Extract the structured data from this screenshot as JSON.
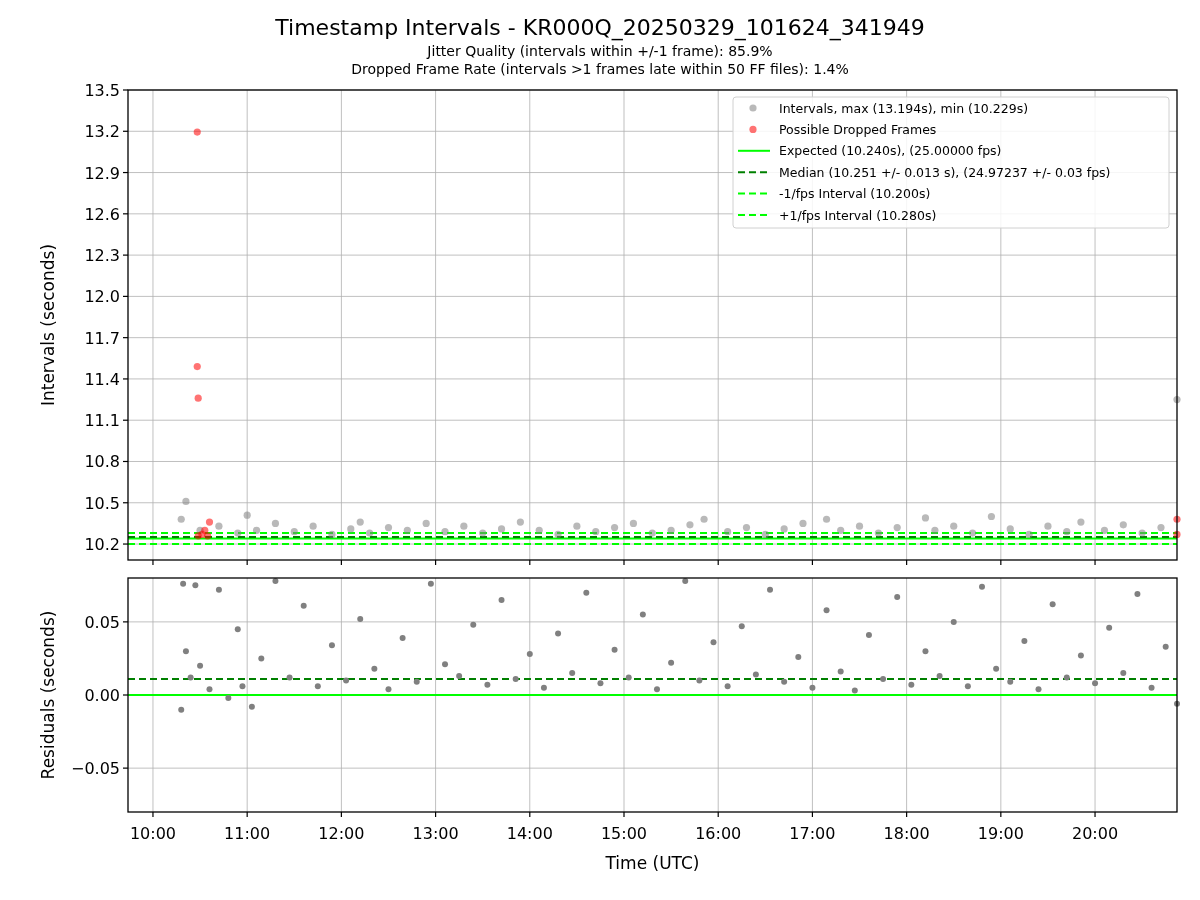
{
  "figure": {
    "title": "Timestamp Intervals - KR000Q_20250329_101624_341949",
    "subtitle_lines": [
      "Jitter Quality (intervals within +/-1 frame): 85.9%",
      "Dropped Frame Rate (intervals >1 frames late within 50 FF files): 1.4%"
    ]
  },
  "charts": [
    {
      "chart_data": {
        "type": "scatter",
        "grid": true,
        "legend": true,
        "ylabel": "Intervals (seconds)",
        "xlim": [
          9.735,
          20.87
        ],
        "ylim": [
          10.084,
          13.5
        ],
        "yticks": [
          {
            "value": 10.2,
            "label": "10.2"
          },
          {
            "value": 10.5,
            "label": "10.5"
          },
          {
            "value": 10.8,
            "label": "10.8"
          },
          {
            "value": 11.1,
            "label": "11.1"
          },
          {
            "value": 11.4,
            "label": "11.4"
          },
          {
            "value": 11.7,
            "label": "11.7"
          },
          {
            "value": 12.0,
            "label": "12.0"
          },
          {
            "value": 12.3,
            "label": "12.3"
          },
          {
            "value": 12.6,
            "label": "12.6"
          },
          {
            "value": 12.9,
            "label": "12.9"
          },
          {
            "value": 13.2,
            "label": "13.2"
          },
          {
            "value": 13.5,
            "label": "13.5"
          }
        ],
        "series": [
          {
            "name": "Intervals, max (13.194s), min (10.229s)",
            "type": "scatter",
            "color": "#808080",
            "x": [
              10.3,
              10.35,
              10.5,
              10.7,
              10.9,
              11.0,
              11.1,
              11.3,
              11.5,
              11.7,
              11.9,
              12.1,
              12.2,
              12.3,
              12.5,
              12.7,
              12.9,
              13.1,
              13.3,
              13.5,
              13.7,
              13.9,
              14.1,
              14.3,
              14.5,
              14.7,
              14.9,
              15.1,
              15.3,
              15.5,
              15.7,
              15.85,
              16.1,
              16.3,
              16.5,
              16.7,
              16.9,
              17.15,
              17.3,
              17.5,
              17.7,
              17.9,
              18.2,
              18.3,
              18.5,
              18.7,
              18.9,
              19.1,
              19.3,
              19.5,
              19.7,
              19.85,
              20.1,
              20.3,
              20.5,
              20.7,
              20.87
            ],
            "values": [
              10.38,
              10.51,
              10.3,
              10.33,
              10.28,
              10.41,
              10.3,
              10.35,
              10.29,
              10.33,
              10.27,
              10.31,
              10.36,
              10.28,
              10.32,
              10.3,
              10.35,
              10.29,
              10.33,
              10.28,
              10.31,
              10.36,
              10.3,
              10.27,
              10.33,
              10.29,
              10.32,
              10.35,
              10.28,
              10.3,
              10.34,
              10.38,
              10.29,
              10.32,
              10.27,
              10.31,
              10.35,
              10.38,
              10.3,
              10.33,
              10.28,
              10.32,
              10.39,
              10.3,
              10.33,
              10.28,
              10.4,
              10.31,
              10.27,
              10.33,
              10.29,
              10.36,
              10.3,
              10.34,
              10.28,
              10.32,
              11.25
            ]
          },
          {
            "name": "Possible Dropped Frames",
            "type": "scatter",
            "color": "#ff0000",
            "x": [
              10.47,
              10.47,
              10.48,
              10.48,
              10.52,
              10.55,
              10.58,
              10.6,
              20.87,
              20.87
            ],
            "values": [
              13.194,
              11.49,
              11.26,
              10.26,
              10.27,
              10.3,
              10.26,
              10.36,
              10.38,
              10.27
            ]
          },
          {
            "name": "Expected (10.240s), (25.00000 fps)",
            "type": "line",
            "color": "#00ff00",
            "x": [
              9.735,
              20.87
            ],
            "values": [
              10.24,
              10.24
            ]
          },
          {
            "name": "Median (10.251 +/- 0.013 s), (24.97237 +/- 0.03 fps)",
            "type": "line",
            "line_style": "dashed",
            "color": "#008000",
            "x": [
              9.735,
              20.87
            ],
            "values": [
              10.251,
              10.251
            ]
          },
          {
            "name": "-1/fps Interval (10.200s)",
            "type": "line",
            "line_style": "dashed",
            "color": "#00ff00",
            "x": [
              9.735,
              20.87
            ],
            "values": [
              10.2,
              10.2
            ]
          },
          {
            "name": "+1/fps Interval (10.280s)",
            "type": "line",
            "line_style": "dashed",
            "color": "#00ff00",
            "x": [
              9.735,
              20.87
            ],
            "values": [
              10.28,
              10.28
            ]
          }
        ]
      }
    },
    {
      "chart_data": {
        "type": "scatter",
        "grid": true,
        "xlabel": "Time (UTC)",
        "ylabel": "Residuals (seconds)",
        "xlim": [
          9.735,
          20.87
        ],
        "ylim": [
          -0.08,
          0.08
        ],
        "xticks": [
          {
            "value": 10,
            "label": "10:00"
          },
          {
            "value": 11,
            "label": "11:00"
          },
          {
            "value": 12,
            "label": "12:00"
          },
          {
            "value": 13,
            "label": "13:00"
          },
          {
            "value": 14,
            "label": "14:00"
          },
          {
            "value": 15,
            "label": "15:00"
          },
          {
            "value": 16,
            "label": "16:00"
          },
          {
            "value": 17,
            "label": "17:00"
          },
          {
            "value": 18,
            "label": "18:00"
          },
          {
            "value": 19,
            "label": "19:00"
          },
          {
            "value": 20,
            "label": "20:00"
          }
        ],
        "yticks": [
          {
            "value": -0.05,
            "label": "−0.05"
          },
          {
            "value": 0,
            "label": "0.00"
          },
          {
            "value": 0.05,
            "label": "0.05"
          }
        ],
        "series": [
          {
            "type": "scatter",
            "color": "#808080",
            "x": [
              10.3,
              10.32,
              10.35,
              10.4,
              10.45,
              10.5,
              10.6,
              10.7,
              10.8,
              10.9,
              10.95,
              11.05,
              11.15,
              11.3,
              11.45,
              11.6,
              11.75,
              11.9,
              12.05,
              12.2,
              12.35,
              12.5,
              12.65,
              12.8,
              12.95,
              13.1,
              13.25,
              13.4,
              13.55,
              13.7,
              13.85,
              14.0,
              14.15,
              14.3,
              14.45,
              14.6,
              14.75,
              14.9,
              15.05,
              15.2,
              15.35,
              15.5,
              15.65,
              15.8,
              15.95,
              16.1,
              16.25,
              16.4,
              16.55,
              16.7,
              16.85,
              17.0,
              17.15,
              17.3,
              17.45,
              17.6,
              17.75,
              17.9,
              18.05,
              18.2,
              18.35,
              18.5,
              18.65,
              18.8,
              18.95,
              19.1,
              19.25,
              19.4,
              19.55,
              19.7,
              19.85,
              20.0,
              20.15,
              20.3,
              20.45,
              20.6,
              20.75,
              20.87
            ],
            "values": [
              -0.01,
              0.076,
              0.03,
              0.012,
              0.075,
              0.02,
              0.004,
              0.072,
              -0.002,
              0.045,
              0.006,
              -0.008,
              0.025,
              0.078,
              0.012,
              0.061,
              0.006,
              0.034,
              0.01,
              0.052,
              0.018,
              0.004,
              0.039,
              0.009,
              0.076,
              0.021,
              0.013,
              0.048,
              0.007,
              0.065,
              0.011,
              0.028,
              0.005,
              0.042,
              0.015,
              0.07,
              0.008,
              0.031,
              0.012,
              0.055,
              0.004,
              0.022,
              0.078,
              0.01,
              0.036,
              0.006,
              0.047,
              0.014,
              0.072,
              0.009,
              0.026,
              0.005,
              0.058,
              0.016,
              0.003,
              0.041,
              0.011,
              0.067,
              0.007,
              0.03,
              0.013,
              0.05,
              0.006,
              0.074,
              0.018,
              0.009,
              0.037,
              0.004,
              0.062,
              0.012,
              0.027,
              0.008,
              0.046,
              0.015,
              0.069,
              0.005,
              0.033,
              -0.006
            ]
          },
          {
            "type": "line",
            "line_style": "dashed",
            "color": "#008000",
            "x": [
              9.735,
              20.87
            ],
            "values": [
              0.011,
              0.011
            ]
          },
          {
            "type": "line",
            "color": "#00ff00",
            "x": [
              9.735,
              20.87
            ],
            "values": [
              0,
              0
            ]
          }
        ]
      }
    }
  ]
}
